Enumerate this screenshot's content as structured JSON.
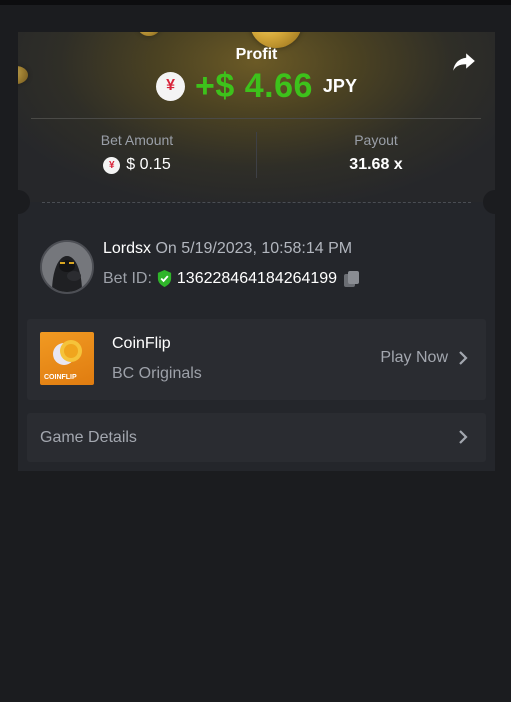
{
  "profit": {
    "label": "Profit",
    "currency_symbol": "¥",
    "value": "+$ 4.66",
    "currency": "JPY",
    "value_color": "#3dc21b"
  },
  "share_icon": "share-arrow-icon",
  "bet_amount": {
    "label": "Bet Amount",
    "currency_symbol": "¥",
    "value": "$ 0.15"
  },
  "payout": {
    "label": "Payout",
    "value": "31.68 x"
  },
  "bet_info": {
    "user": "Lord⁥sx",
    "date_text": "On 5/19/2023, 10:58:14 PM",
    "bet_id_label": "Bet ID:",
    "bet_id": "136228464184264199"
  },
  "game": {
    "title": "CoinFlip",
    "subtitle": "BC Originals",
    "thumb_text": "COINFLIP",
    "play_label": "Play Now"
  },
  "details": {
    "label": "Game Details"
  },
  "colors": {
    "background": "#1b1c1f",
    "card": "#24262b",
    "panel": "#2a2c31",
    "profit_green": "#3dc21b",
    "yen_red": "#d8243a",
    "shield_green": "#2fb52a"
  }
}
